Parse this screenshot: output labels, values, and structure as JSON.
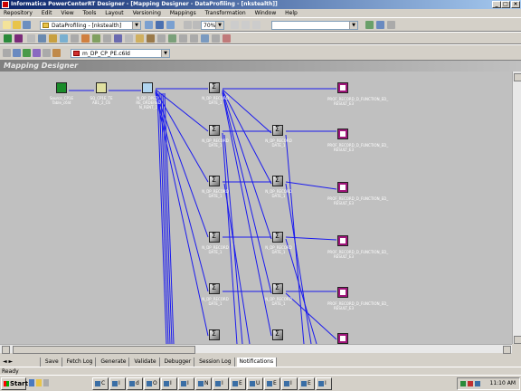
{
  "window": {
    "title": "Informatica PowerCenterRT Designer - [Mapping Designer - DataProfiling - [nkstealth]]"
  },
  "menu": [
    "Repository",
    "Edit",
    "View",
    "Tools",
    "Layout",
    "Versioning",
    "Mappings",
    "Transformation",
    "Window",
    "Help"
  ],
  "toolbar": {
    "zoom": "70%",
    "repo_combo": "DataProfiling - [nkstealth]",
    "mapping_combo": "m_DP_CP_PE.c6ld"
  },
  "workspace": {
    "title": "Mapping Designer"
  },
  "canvas": {
    "source_label": "Source_CP1E Table_c6ld",
    "sq_label": "SQ_CP1E_TE AB1_2_C6",
    "fil_label": "N_DP_DPED_ RE_ORDERED N_RENT_1",
    "exprA_label": "N_DP_RECORD DATE_1",
    "exprB_label": "N_DP_RECORD DATE_1",
    "target_label": "PROF_RECORD_D_FUNCTION_ED_ RESULT_E3"
  },
  "tabs": [
    "Save",
    "Fetch Log",
    "Generate",
    "Validate",
    "Debugger",
    "Session Log",
    "Notifications"
  ],
  "status": "Ready",
  "taskbar": {
    "start": "Start",
    "tasks": [
      "C",
      "I",
      "d",
      "O",
      "I",
      "I",
      "N",
      "I",
      "E",
      "U",
      "E",
      "I",
      "E",
      "I"
    ],
    "clock": "11:10 AM"
  }
}
